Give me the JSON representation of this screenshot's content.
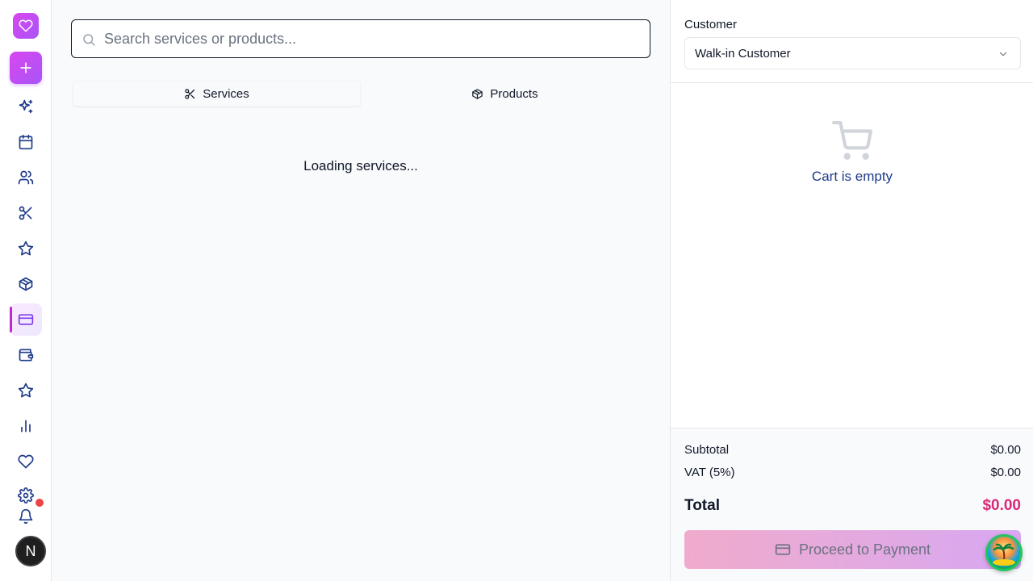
{
  "sidebar": {
    "logo_icon": "heart-icon",
    "new_button_icon": "plus-icon",
    "items": [
      {
        "name": "sparkles",
        "icon": "sparkles-icon"
      },
      {
        "name": "calendar",
        "icon": "calendar-icon"
      },
      {
        "name": "clients",
        "icon": "users-icon"
      },
      {
        "name": "services",
        "icon": "scissors-icon"
      },
      {
        "name": "reviews",
        "icon": "star-icon"
      },
      {
        "name": "products",
        "icon": "package-icon"
      },
      {
        "name": "pos",
        "icon": "credit-card-icon",
        "active": true
      },
      {
        "name": "wallet",
        "icon": "wallet-icon"
      },
      {
        "name": "loyalty",
        "icon": "star-icon"
      },
      {
        "name": "reports",
        "icon": "bar-chart-icon"
      },
      {
        "name": "favorites",
        "icon": "heart-icon"
      },
      {
        "name": "settings",
        "icon": "gear-icon"
      }
    ],
    "notifications_icon": "bell-icon",
    "avatar_initial": "N"
  },
  "main": {
    "search_placeholder": "Search services or products...",
    "search_value": "",
    "tabs": [
      {
        "label": "Services",
        "icon": "scissors-icon",
        "active": true
      },
      {
        "label": "Products",
        "icon": "package-icon",
        "active": false
      }
    ],
    "loading_text": "Loading services..."
  },
  "cart": {
    "customer_label": "Customer",
    "customer_value": "Walk-in Customer",
    "empty_text": "Cart is empty",
    "subtotal_label": "Subtotal",
    "subtotal_value": "$0.00",
    "vat_label": "VAT (5%)",
    "vat_value": "$0.00",
    "total_label": "Total",
    "total_value": "$0.00",
    "pay_button_label": "Proceed to Payment"
  },
  "colors": {
    "accent": "#d946ef",
    "total_amount": "#db2777",
    "nav_icon": "#1e3a8a"
  }
}
